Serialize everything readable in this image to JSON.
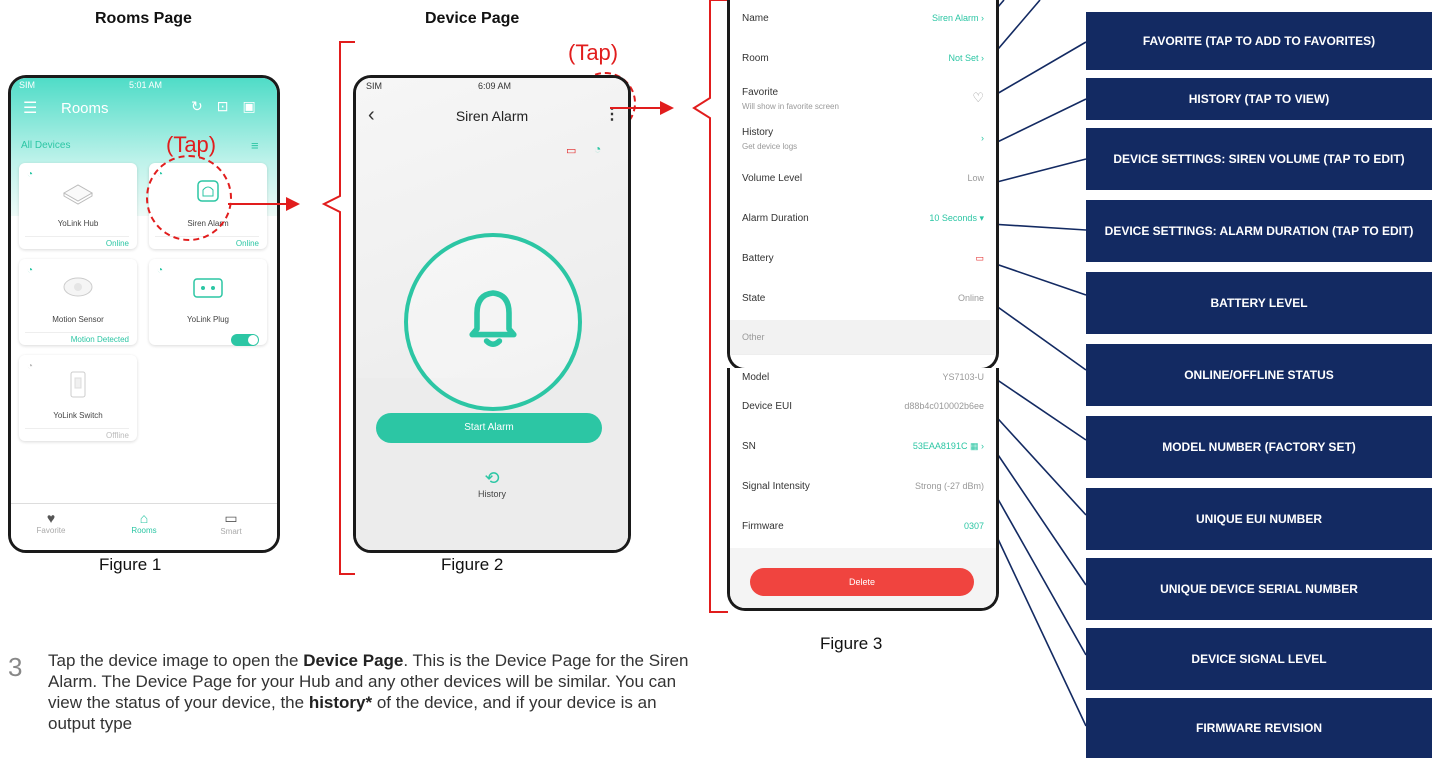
{
  "labels": {
    "rooms_page": "Rooms Page",
    "device_page": "Device Page",
    "tap": "(Tap)",
    "figure1": "Figure 1",
    "figure2": "Figure 2",
    "figure3": "Figure 3"
  },
  "rooms_screen": {
    "carrier": "SIM",
    "time": "5:01 AM",
    "title": "Rooms",
    "all_devices": "All Devices",
    "tiles": [
      {
        "name": "YoLink Hub",
        "status": "Online"
      },
      {
        "name": "Siren Alarm",
        "status": "Online"
      },
      {
        "name": "Motion Sensor",
        "status": "Motion Detected"
      },
      {
        "name": "YoLink Plug",
        "status": ""
      },
      {
        "name": "YoLink Switch",
        "status": "Offline"
      }
    ],
    "tabs": [
      "Favorite",
      "Rooms",
      "Smart"
    ]
  },
  "device_screen": {
    "carrier": "SIM",
    "time": "6:09 AM",
    "title": "Siren Alarm",
    "start_button": "Start Alarm",
    "history": "History"
  },
  "details_screen": {
    "rows": [
      {
        "label": "Name",
        "value": "Siren Alarm"
      },
      {
        "label": "Room",
        "value": "Not Set"
      },
      {
        "label": "Favorite",
        "sub": "Will show in favorite screen"
      },
      {
        "label": "History",
        "sub": "Get device logs"
      },
      {
        "label": "Volume Level",
        "value": "Low"
      },
      {
        "label": "Alarm Duration",
        "value": "10 Seconds"
      },
      {
        "label": "Battery"
      },
      {
        "label": "State",
        "value": "Online"
      },
      {
        "label": "Other"
      },
      {
        "label": "Model",
        "value": "YS7103-U"
      },
      {
        "label": "Device EUI",
        "value": "d88b4c010002b6ee"
      },
      {
        "label": "SN",
        "value": "53EAA8191C"
      },
      {
        "label": "Signal Intensity",
        "value": "Strong (-27 dBm)"
      },
      {
        "label": "Firmware",
        "value": "0307"
      }
    ],
    "delete": "Delete"
  },
  "callouts": [
    "FAVORITE (TAP TO ADD TO FAVORITES)",
    "HISTORY (TAP TO VIEW)",
    "DEVICE SETTINGS: SIREN VOLUME (TAP TO EDIT)",
    "DEVICE SETTINGS: ALARM DURATION (TAP TO EDIT)",
    "BATTERY LEVEL",
    "ONLINE/OFFLINE STATUS",
    "MODEL NUMBER (FACTORY SET)",
    "UNIQUE EUI NUMBER",
    "UNIQUE DEVICE SERIAL NUMBER",
    "DEVICE SIGNAL LEVEL",
    "FIRMWARE REVISION"
  ],
  "step": {
    "number": "3",
    "t1": "Tap the device image to open the ",
    "b1": "Device Page",
    "t2": ". This is the Device Page for the Siren Alarm. The Device Page for your Hub and any other devices will be similar. You can view the status of your device, the ",
    "b2": "history*",
    "t3": " of the device, and if your device is an output type"
  },
  "colors": {
    "teal": "#2cc6a4",
    "navy": "#132a62",
    "red": "#e11d1d"
  }
}
